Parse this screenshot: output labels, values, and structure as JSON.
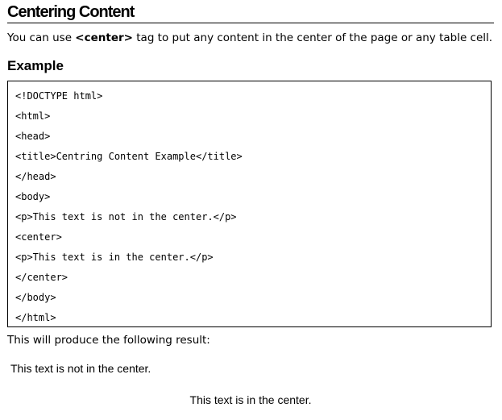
{
  "heading": "Centering Content",
  "intro": {
    "before": "You can use ",
    "tag": "<center>",
    "after": " tag to put any content in the center of the page or any table cell."
  },
  "example_heading": "Example",
  "code_lines": [
    "<!DOCTYPE html>",
    "<html>",
    "<head>",
    "<title>Centring Content Example</title>",
    "</head>",
    "<body>",
    "<p>This text is not in the center.</p>",
    "<center>",
    "<p>This text is in the center.</p>",
    "</center>",
    "</body>",
    "</html>"
  ],
  "result_intro": "This will produce the following result:",
  "result": {
    "not_centered": "This text is not in the center.",
    "centered": "This text is in the center."
  }
}
